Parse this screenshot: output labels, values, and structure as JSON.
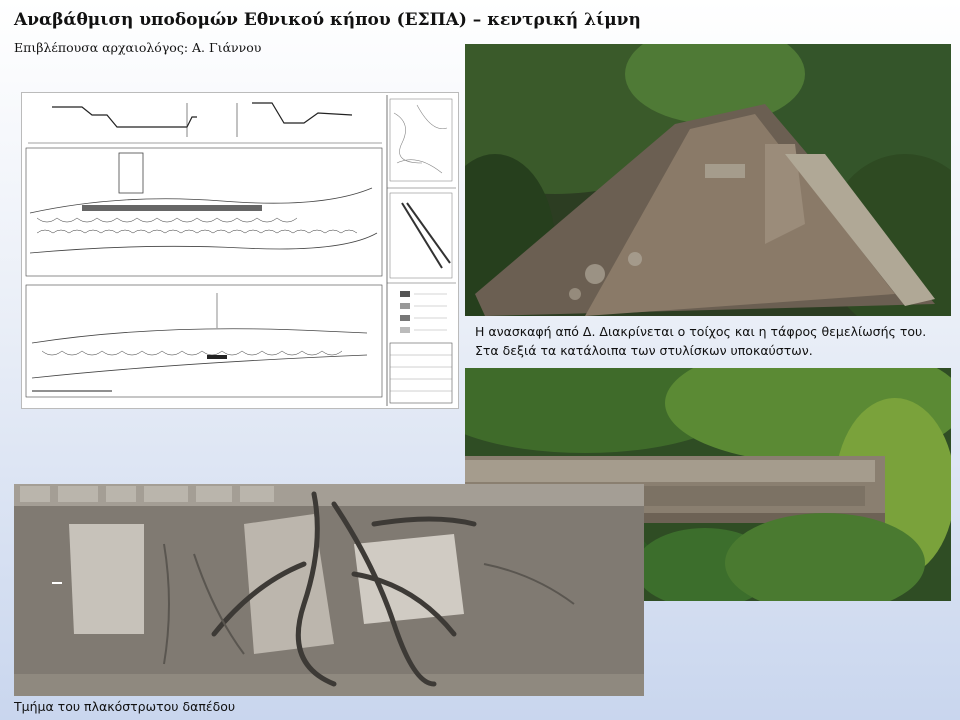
{
  "slide": {
    "title": "Αναβάθμιση υποδομών Εθνικού κήπου (ΕΣΠΑ) – κεντρική λίμνη",
    "subtitle": "Επιβλέπουσα αρχαιολόγος: Α. Γιάννου"
  },
  "photo_top": {
    "caption_line1": "Η ανασκαφή από Δ. Διακρίνεται ο τοίχος και η τάφρος θεμελίωσής του.",
    "caption_line2": "Στα δεξιά τα κατάλοιπα των στυλίσκων υποκαύστων."
  },
  "photo_bottom": {
    "caption": "Τμήμα του πλακόστρωτου δαπέδου"
  },
  "colors": {
    "vegetation": "#3f6b2a",
    "soil": "#8a7a68",
    "stone": "#a9a297"
  }
}
